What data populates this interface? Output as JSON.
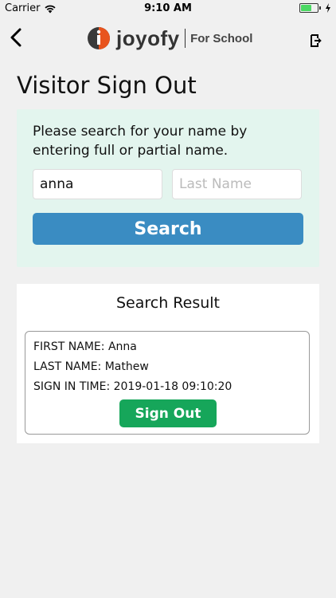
{
  "status_bar": {
    "carrier": "Carrier",
    "time": "9:10 AM",
    "battery_level": 0.6
  },
  "nav": {
    "logo_text": "joyofy",
    "logo_sub": "For School",
    "back_icon": "chevron-left-icon",
    "signout_icon": "sign-out-icon"
  },
  "page": {
    "title": "Visitor Sign Out"
  },
  "search": {
    "instructions": "Please search for your name by entering full or partial name.",
    "first_name_value": "anna",
    "last_name_placeholder": "Last Name",
    "button_label": "Search"
  },
  "result": {
    "heading": "Search Result",
    "first_name_line": "FIRST NAME: Anna",
    "last_name_line": "LAST NAME: Mathew",
    "sign_in_time_line": "SIGN IN TIME: 2019-01-18 09:10:20",
    "signout_label": "Sign Out"
  },
  "colors": {
    "search_panel_bg": "#e3f5ee",
    "search_button": "#3a8cc2",
    "signout_button": "#16a65a",
    "logo_accent": "#e8541e"
  }
}
